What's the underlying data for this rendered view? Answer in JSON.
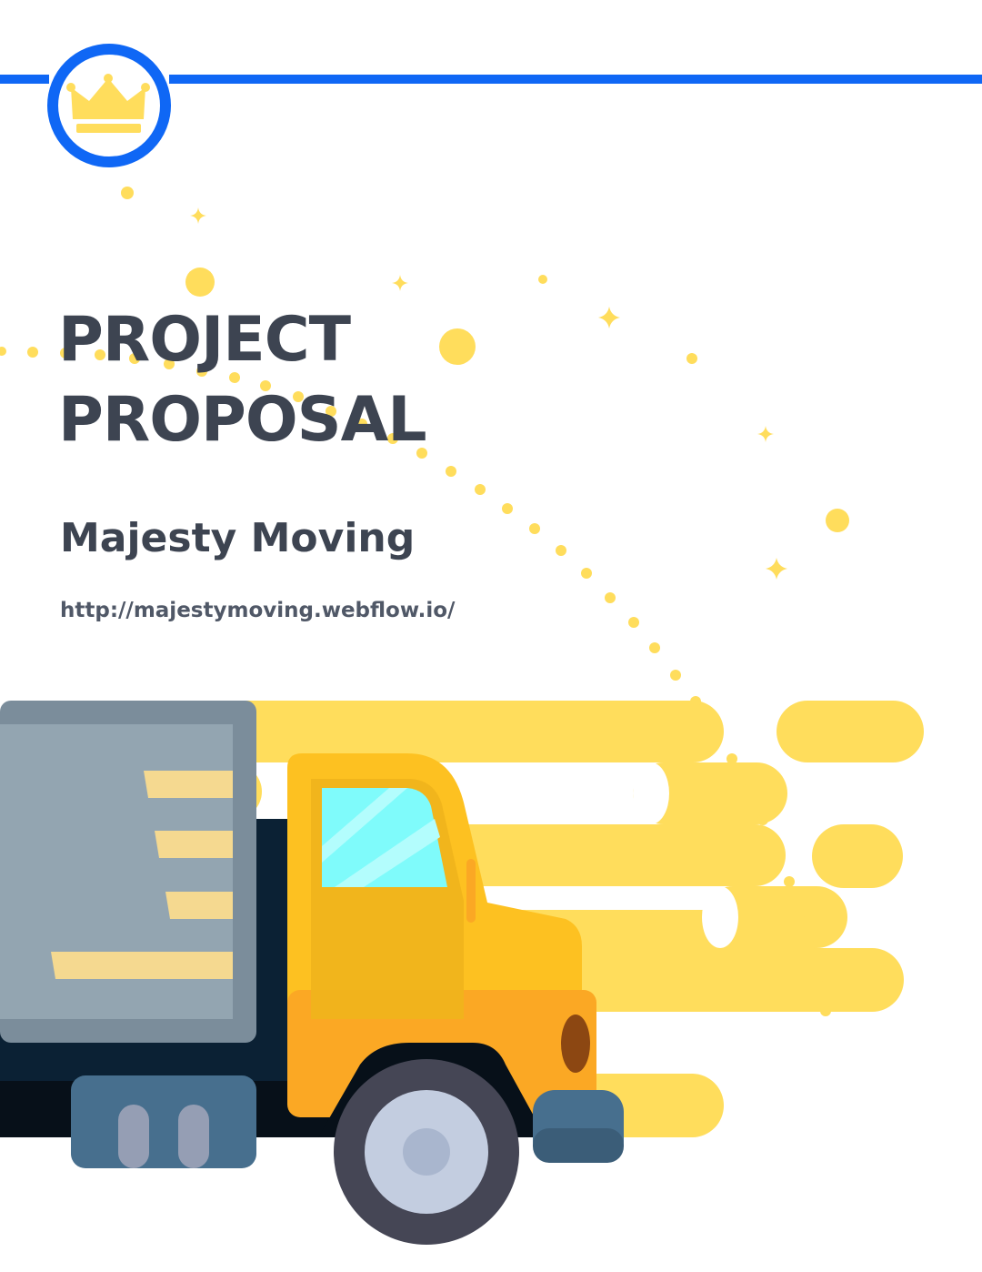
{
  "document": {
    "title_line_1": "PROJECT",
    "title_line_2": "PROPOSAL",
    "company": "Majesty Moving",
    "url": "http://majestymoving.webflow.io/"
  },
  "colors": {
    "accent_blue": "#0f67f5",
    "crown_yellow": "#ffdd5c",
    "text_dark": "#3d4451",
    "truck_cab": "#fdc121",
    "truck_box": "#93a5b1"
  },
  "icons": [
    "crown-icon",
    "sparkle-icon",
    "moving-truck-illustration"
  ]
}
